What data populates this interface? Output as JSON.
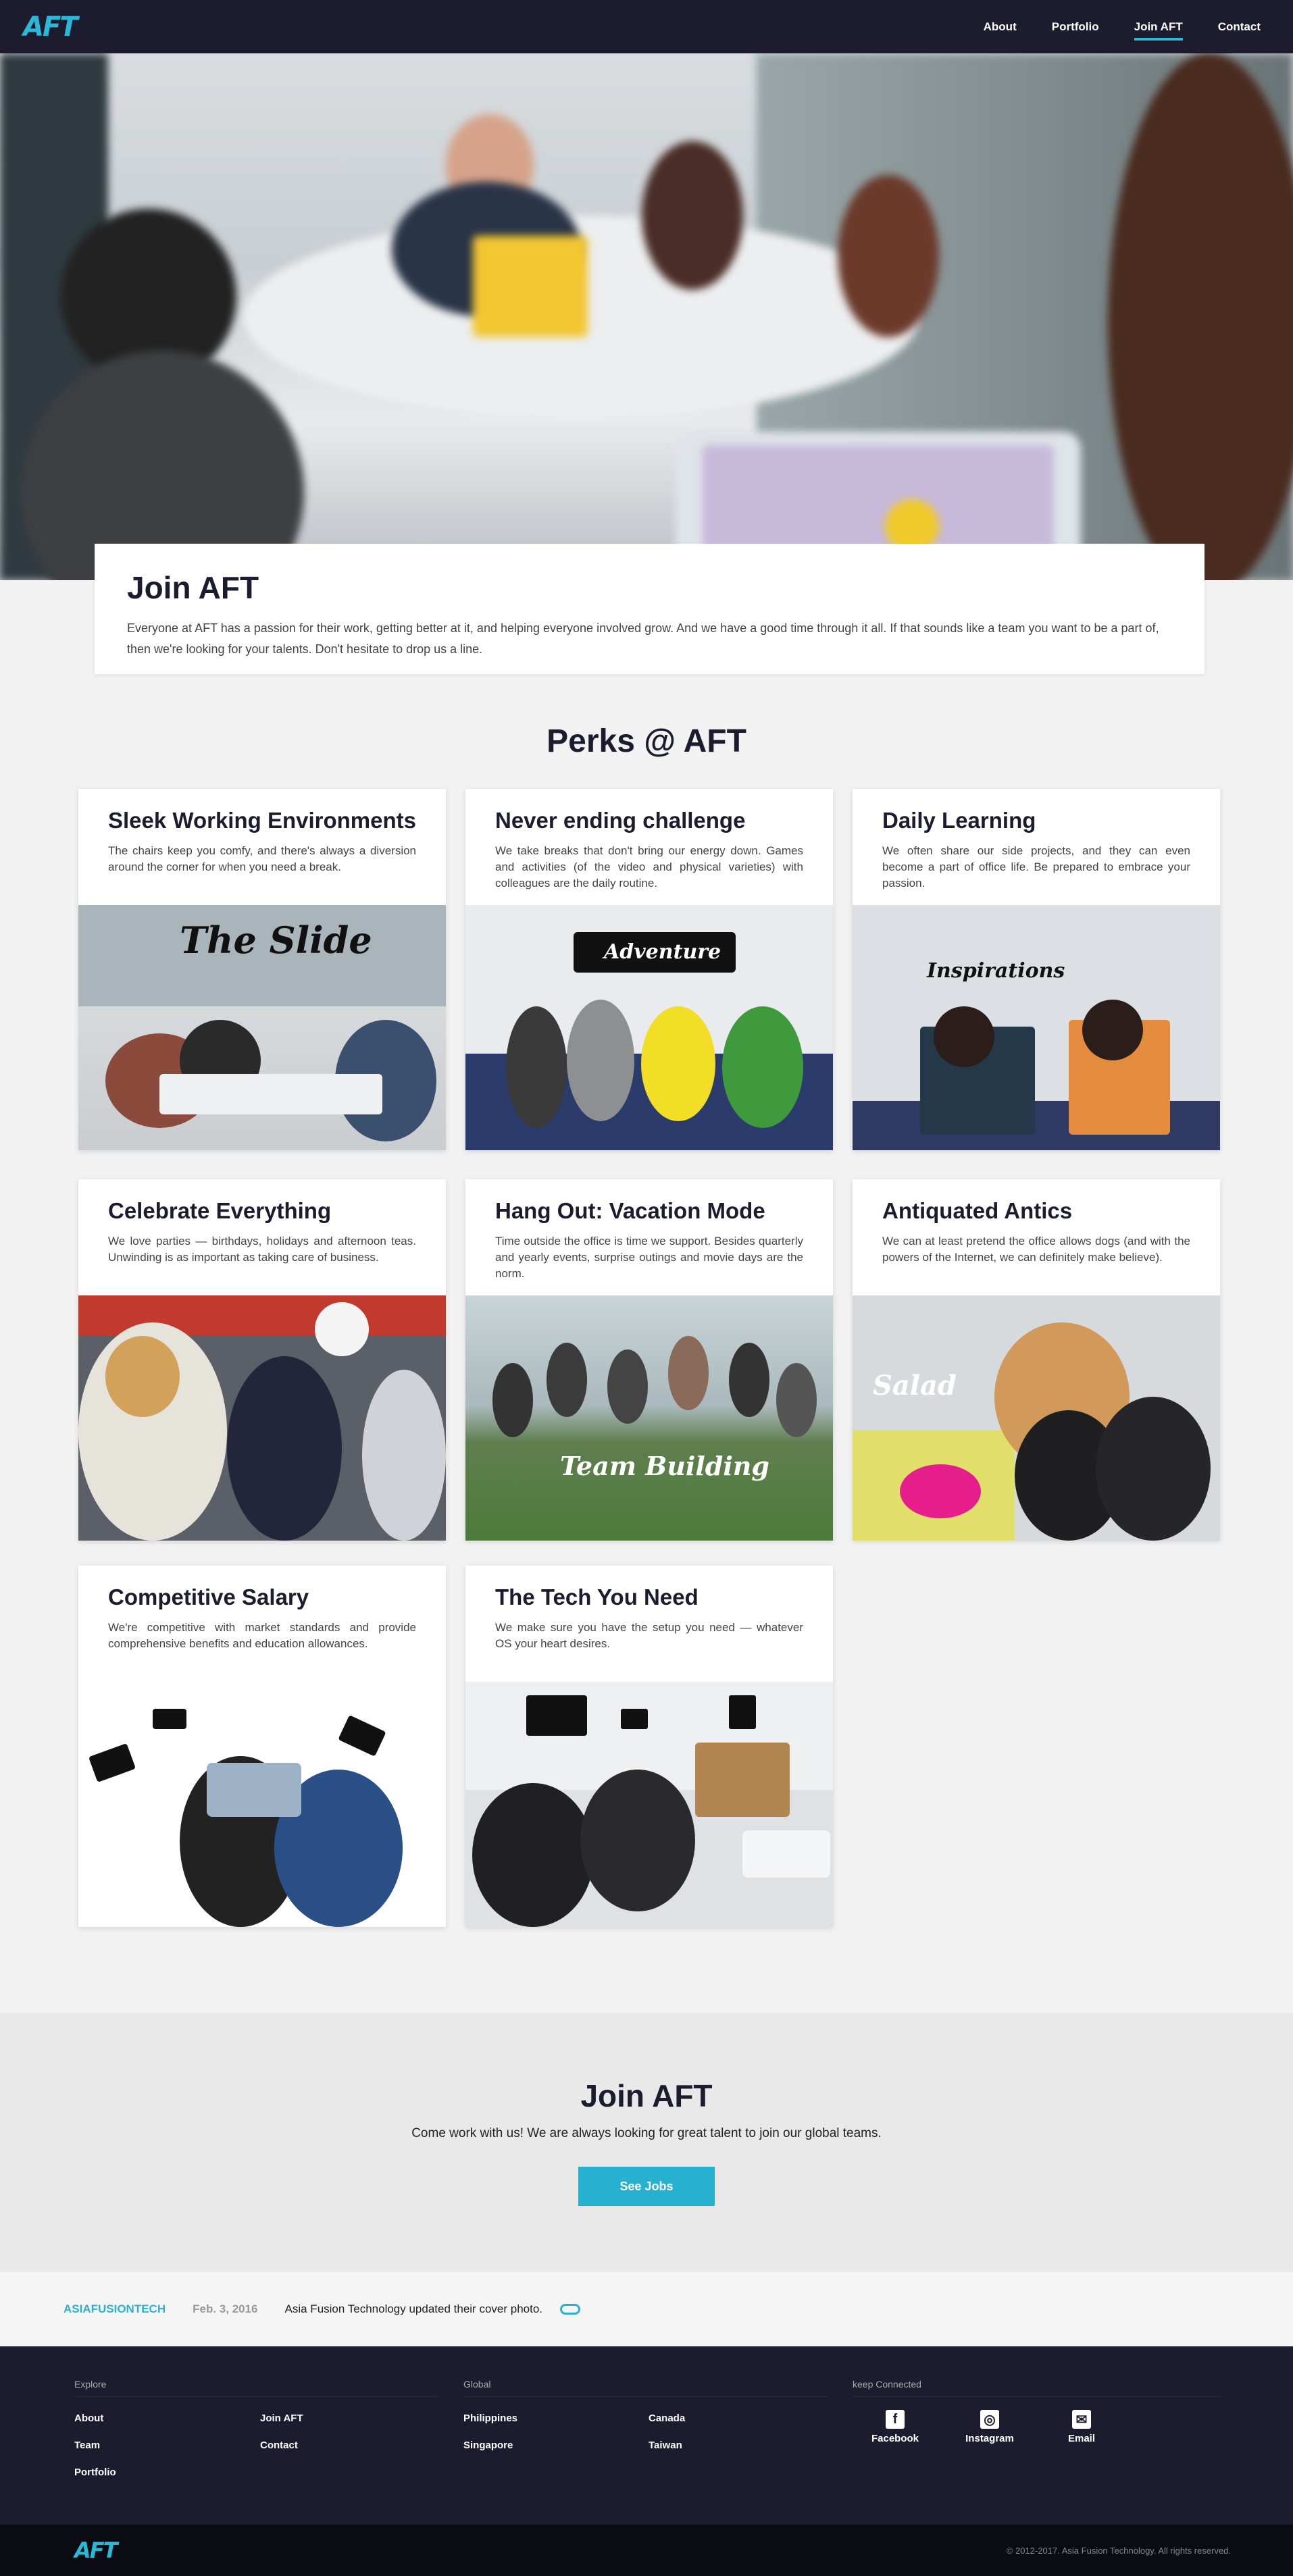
{
  "nav": {
    "logo": "AFT",
    "links": [
      {
        "label": "About"
      },
      {
        "label": "Portfolio"
      },
      {
        "label": "Join AFT"
      },
      {
        "label": "Contact"
      }
    ]
  },
  "intro": {
    "title": "Join AFT",
    "body": "Everyone at AFT has a passion for their work, getting better at it, and helping everyone involved grow. And we have a good time through it all. If that sounds like a team you want to be a part of, then we're looking for your talents. Don't hesitate to drop us a line."
  },
  "perks": {
    "title": "Perks @ AFT",
    "cards": [
      {
        "title": "Sleek Working Environments",
        "body": "The chairs keep you comfy, and there's always a diversion around the corner for when you need a break.",
        "overlay": "The Slide"
      },
      {
        "title": "Never ending challenge",
        "body": "We take breaks that don't bring our energy down. Games and activities (of the video and physical varieties) with colleagues are the daily routine.",
        "overlay": "Adventure"
      },
      {
        "title": "Daily Learning",
        "body": "We often share our side projects, and they can even become a part of office life. Be prepared to embrace your passion.",
        "overlay": "Inspirations"
      },
      {
        "title": "Celebrate Everything",
        "body": "We love parties — birthdays, holidays and afternoon teas. Unwinding is as important as taking care of business.",
        "overlay": ""
      },
      {
        "title": "Hang Out: Vacation Mode",
        "body": "Time outside the office is time we support. Besides quarterly and yearly events, surprise outings and movie days are the norm.",
        "overlay": "Team Building"
      },
      {
        "title": "Antiquated Antics",
        "body": "We can at least pretend the office allows dogs (and with the powers of the Internet, we can definitely make believe).",
        "overlay": "Salad"
      },
      {
        "title": "Competitive Salary",
        "body": "We're competitive with market standards and provide comprehensive benefits and education allowances.",
        "overlay": ""
      },
      {
        "title": "The Tech You Need",
        "body": "We make sure you have the setup you need — whatever OS your heart desires.",
        "overlay": ""
      }
    ]
  },
  "cta": {
    "title": "Join AFT",
    "body": "Come work with us! We are always looking for great talent to join our global teams.",
    "button": "See Jobs"
  },
  "feed": {
    "account": "ASIAFUSIONTECH",
    "date": "Feb. 3, 2016",
    "text": "Asia Fusion Technology updated their cover photo."
  },
  "footer": {
    "explore": {
      "heading": "Explore",
      "links": [
        "About",
        "Join AFT",
        "Team",
        "Contact",
        "Portfolio"
      ]
    },
    "global": {
      "heading": "Global",
      "links": [
        "Philippines",
        "Canada",
        "Singapore",
        "Taiwan"
      ]
    },
    "connected": {
      "heading": "keep Connected",
      "links": [
        "Facebook",
        "Instagram",
        "Email"
      ]
    },
    "logo": "AFT",
    "copyright": "© 2012-2017. Asia Fusion Technology. All rights reserved."
  },
  "colors": {
    "navy": "#1c1c2e",
    "accent": "#25b1cf"
  }
}
